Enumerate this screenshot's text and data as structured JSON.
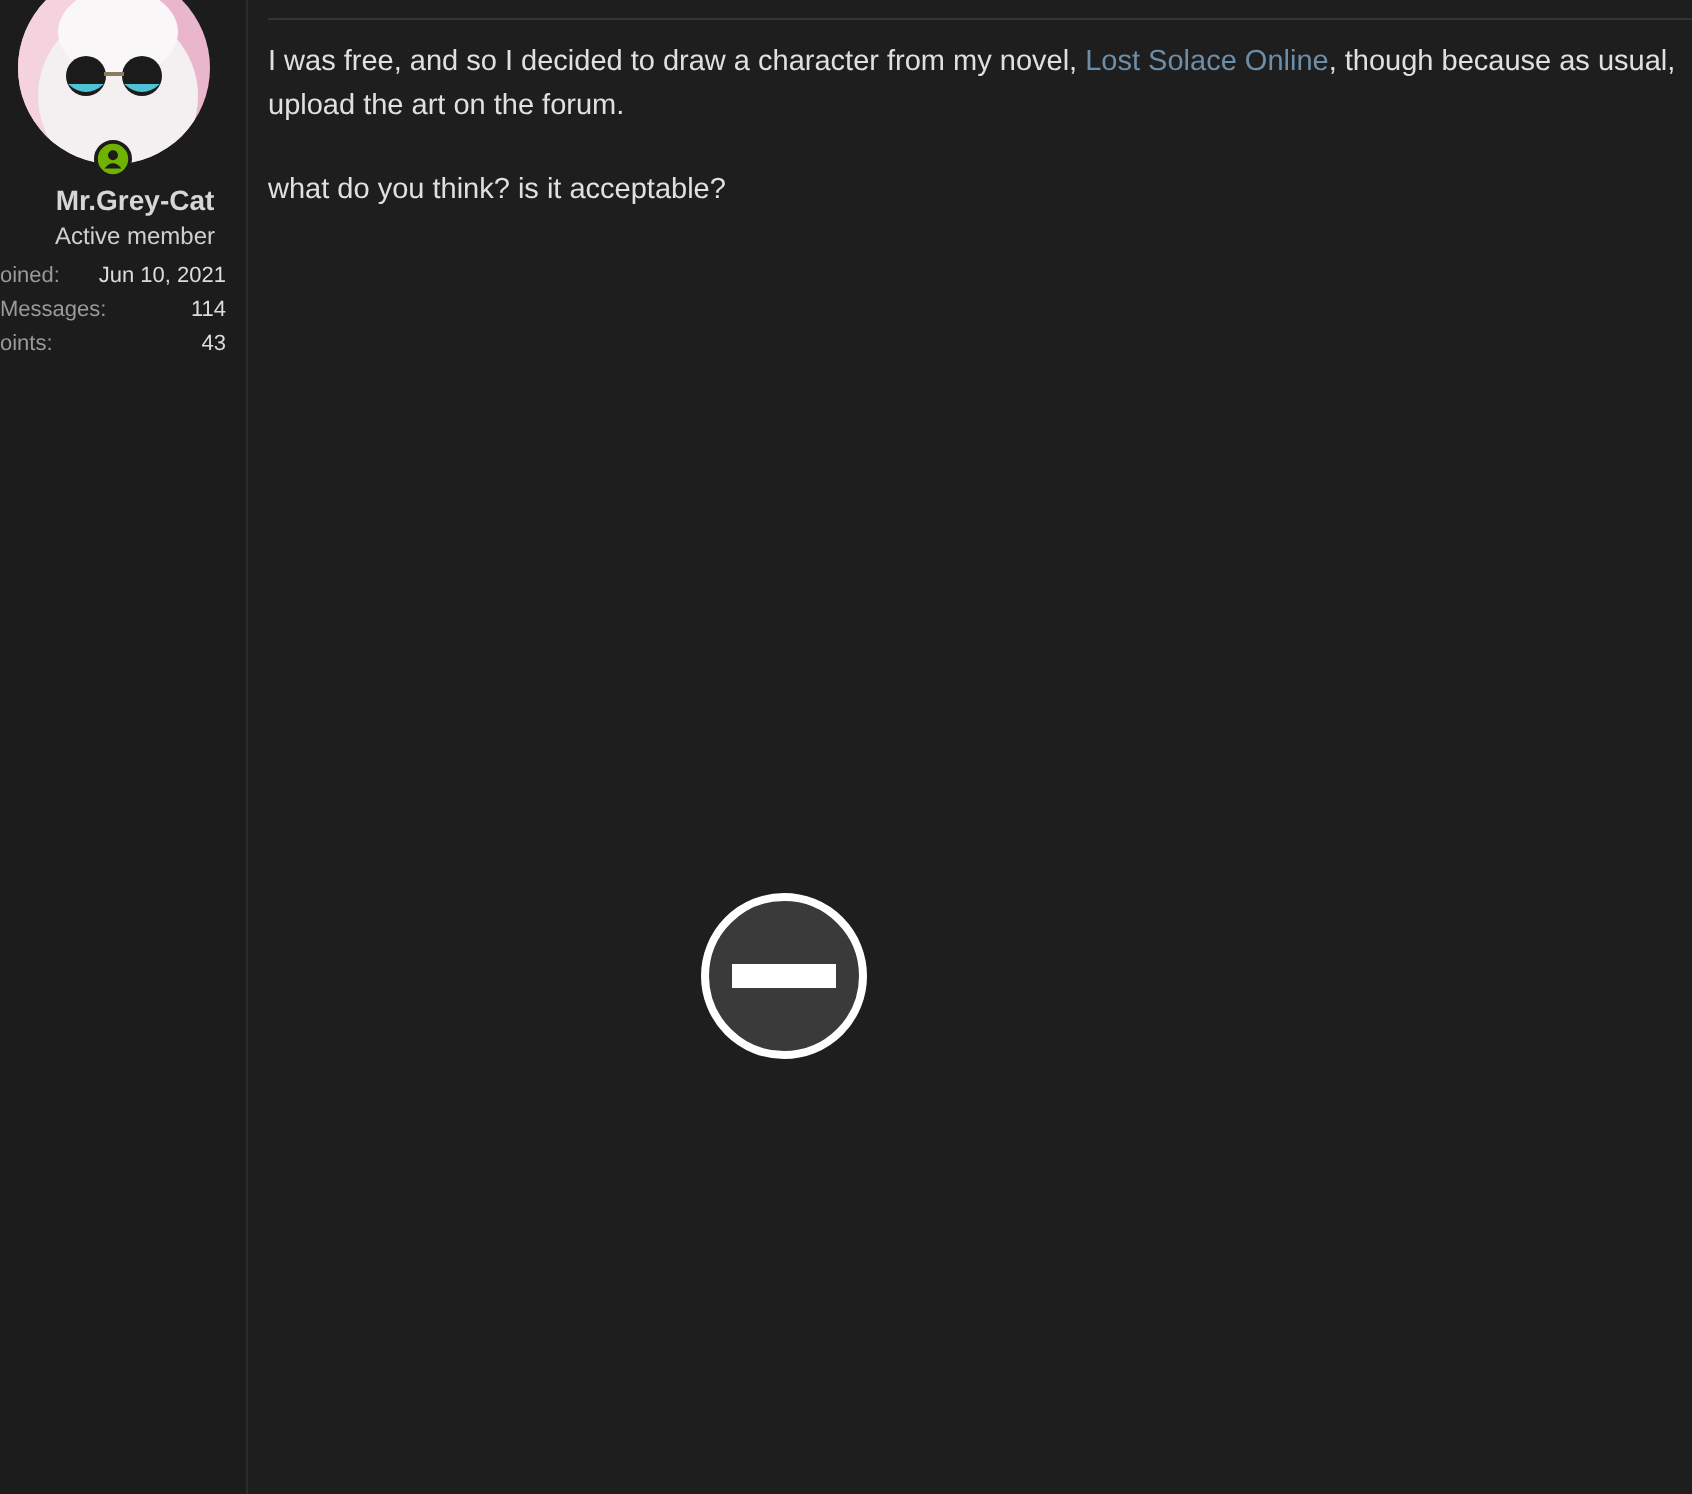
{
  "author": {
    "online": true,
    "name": "Mr.Grey-Cat",
    "title": "Active member",
    "stats": [
      {
        "label": "oined:",
        "value": "Jun 10, 2021"
      },
      {
        "label": "Messages:",
        "value": "114"
      },
      {
        "label": "oints:",
        "value": "43"
      }
    ]
  },
  "message": {
    "lines": [
      {
        "before": "I was free, and so I decided to draw a character from my novel, ",
        "link": "Lost Solace Online",
        "after": ", though because as usual,"
      },
      {
        "before": "upload the art on the forum."
      }
    ],
    "paragraphs": [
      "what do you think? is it acceptable?"
    ]
  },
  "attachment": {
    "blocked": true
  }
}
